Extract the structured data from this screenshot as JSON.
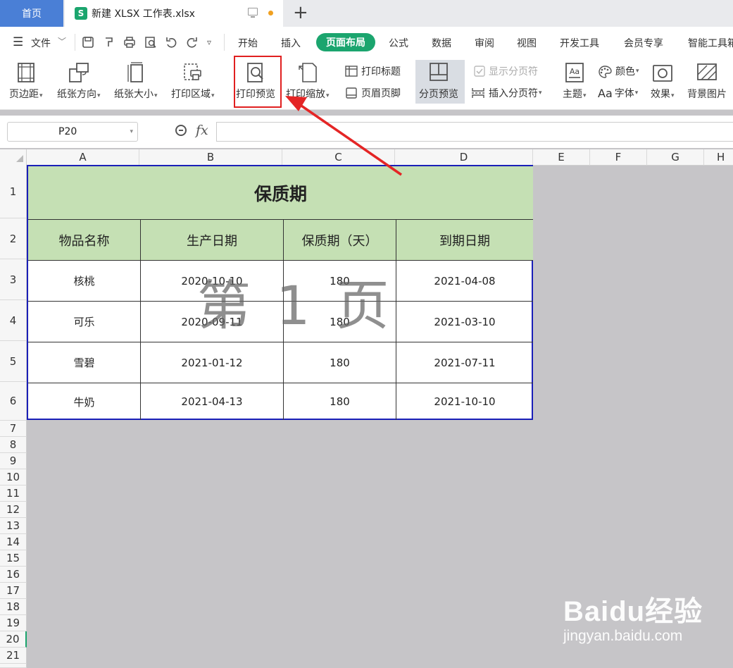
{
  "tabs": {
    "home": "首页",
    "file": "新建 XLSX 工作表.xlsx",
    "logo_letter": "S"
  },
  "menu": {
    "file": "文件",
    "items": [
      "开始",
      "插入",
      "页面布局",
      "公式",
      "数据",
      "审阅",
      "视图",
      "开发工具",
      "会员专享",
      "智能工具箱"
    ],
    "active": "页面布局"
  },
  "ribbon": {
    "margins": "页边距",
    "orientation": "纸张方向",
    "size": "纸张大小",
    "print_area": "打印区域",
    "print_preview": "打印预览",
    "print_scale": "打印缩放",
    "print_titles": "打印标题",
    "header_footer": "页眉页脚",
    "page_break_preview": "分页预览",
    "show_page_breaks": "显示分页符",
    "insert_page_break": "插入分页符",
    "theme": "主题",
    "colors": "颜色",
    "fonts": "字体",
    "fonts_prefix": "Aa",
    "effects": "效果",
    "background": "背景图片"
  },
  "formula_bar": {
    "cell_ref": "P20",
    "fx": "fx",
    "value": ""
  },
  "columns": [
    "A",
    "B",
    "C",
    "D",
    "E",
    "F",
    "G",
    "H"
  ],
  "rows": [
    "1",
    "2",
    "3",
    "4",
    "5",
    "6",
    "7",
    "8",
    "9",
    "10",
    "11",
    "12",
    "13",
    "14",
    "15",
    "16",
    "17",
    "18",
    "19",
    "20",
    "21"
  ],
  "table": {
    "title": "保质期",
    "headers": [
      "物品名称",
      "生产日期",
      "保质期（天）",
      "到期日期"
    ],
    "rows": [
      [
        "核桃",
        "2020-10-10",
        "180",
        "2021-04-08"
      ],
      [
        "可乐",
        "2020-09-11",
        "180",
        "2021-03-10"
      ],
      [
        "雪碧",
        "2021-01-12",
        "180",
        "2021-07-11"
      ],
      [
        "牛奶",
        "2021-04-13",
        "180",
        "2021-10-10"
      ]
    ]
  },
  "page_watermark": "第 1 页",
  "brand_watermark": {
    "main": "Baidu经验",
    "sub": "jingyan.baidu.com"
  },
  "colors": {
    "accent": "#1ba56e",
    "header_fill": "#c5e0b4",
    "page_border": "#1a1fb8",
    "highlight": "#e02020"
  }
}
